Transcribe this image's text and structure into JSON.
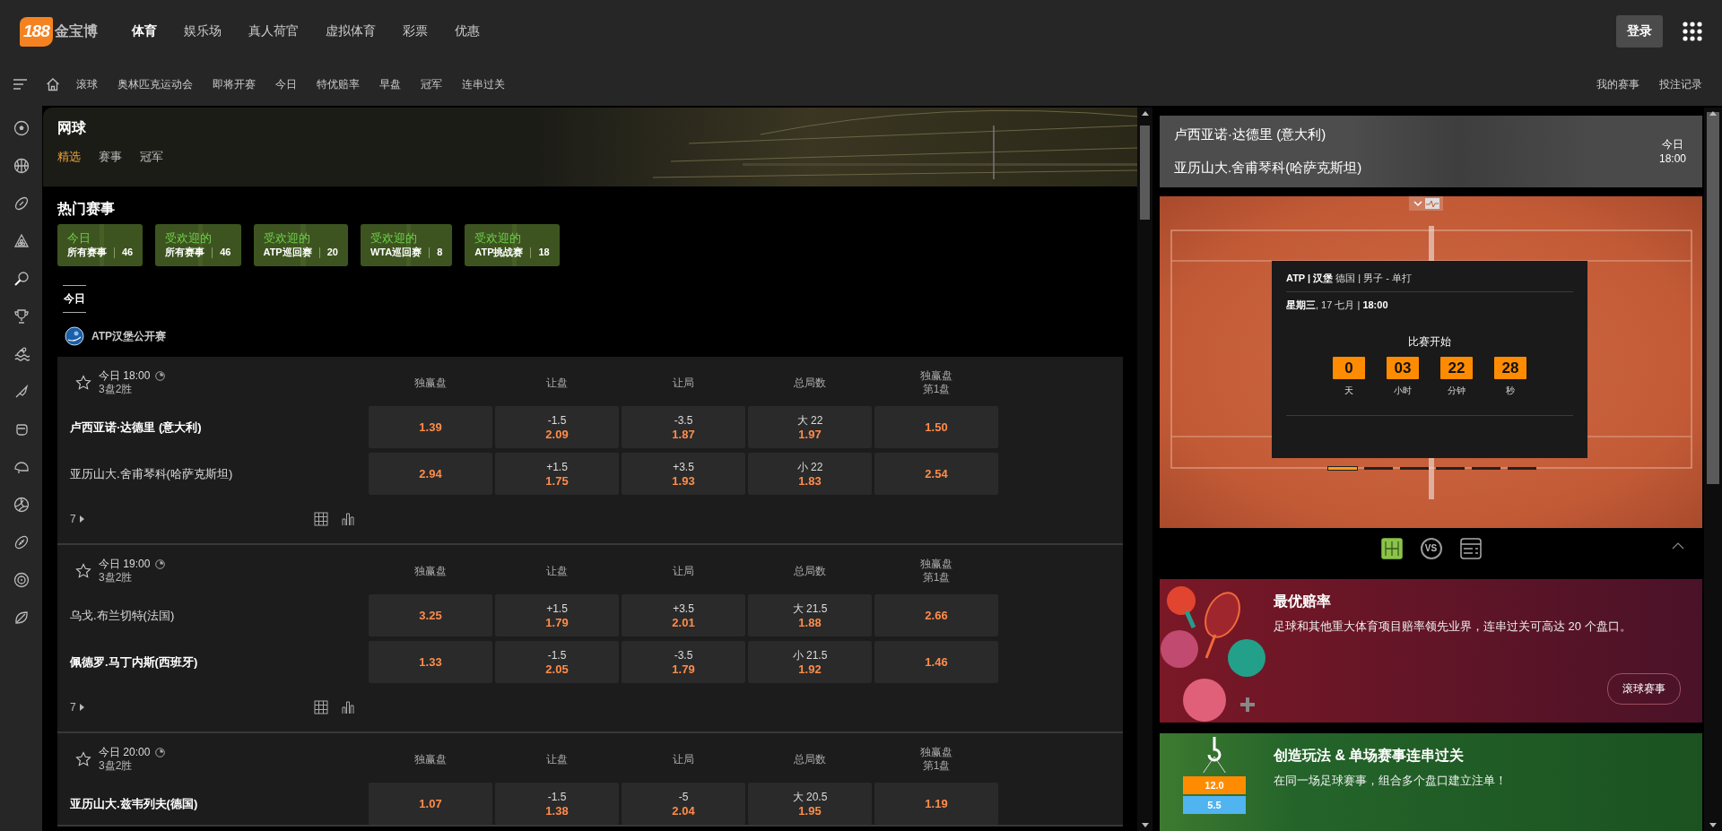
{
  "header": {
    "logo": {
      "badge": "188",
      "text": "金宝博"
    },
    "nav": [
      {
        "label": "体育",
        "selected": true
      },
      {
        "label": "娱乐场",
        "selected": false
      },
      {
        "label": "真人荷官",
        "selected": false
      },
      {
        "label": "虚拟体育",
        "selected": false
      },
      {
        "label": "彩票",
        "selected": false
      },
      {
        "label": "优惠",
        "selected": false
      }
    ],
    "login_button": "登录"
  },
  "subnav": {
    "items": [
      "滚球",
      "奥林匹克运动会",
      "即将开赛",
      "今日",
      "特优赔率",
      "早盘",
      "冠军",
      "连串过关"
    ],
    "links": [
      "我的赛事",
      "投注记录"
    ]
  },
  "sport": {
    "title": "网球",
    "tabs": [
      {
        "label": "精选",
        "selected": true
      },
      {
        "label": "赛事",
        "selected": false
      },
      {
        "label": "冠军",
        "selected": false
      }
    ],
    "hot_title": "热门赛事",
    "hot_events": [
      {
        "top": "今日",
        "label": "所有赛事",
        "count": "46"
      },
      {
        "top": "受欢迎的",
        "label": "所有赛事",
        "count": "46"
      },
      {
        "top": "受欢迎的",
        "label": "ATP巡回赛",
        "count": "20"
      },
      {
        "top": "受欢迎的",
        "label": "WTA巡回赛",
        "count": "8"
      },
      {
        "top": "受欢迎的",
        "label": "ATP挑战赛",
        "count": "18"
      }
    ],
    "date_tabs": [
      {
        "label": "今日",
        "selected": true
      }
    ],
    "league": "ATP汉堡公开赛",
    "matches": [
      {
        "time": "今日 18:00",
        "format": "3盘2胜",
        "columns": [
          {
            "label": "独赢盘"
          },
          {
            "label": "让盘"
          },
          {
            "label": "让局"
          },
          {
            "label": "总局数"
          },
          {
            "label": "独赢盘",
            "sub": "第1盘"
          }
        ],
        "more": "7",
        "teams": [
          {
            "name": "卢西亚诺·达德里 (意大利)",
            "favorite": true,
            "odds": [
              {
                "price": "1.39"
              },
              {
                "line": "-1.5",
                "price": "2.09"
              },
              {
                "line": "-3.5",
                "price": "1.87"
              },
              {
                "line": "大 22",
                "price": "1.97"
              },
              {
                "price": "1.50"
              }
            ]
          },
          {
            "name": "亚历山大.舍甫琴科(哈萨克斯坦)",
            "favorite": false,
            "odds": [
              {
                "price": "2.94"
              },
              {
                "line": "+1.5",
                "price": "1.75"
              },
              {
                "line": "+3.5",
                "price": "1.93"
              },
              {
                "line": "小 22",
                "price": "1.83"
              },
              {
                "price": "2.54"
              }
            ]
          }
        ]
      },
      {
        "time": "今日 19:00",
        "format": "3盘2胜",
        "columns": [
          {
            "label": "独赢盘"
          },
          {
            "label": "让盘"
          },
          {
            "label": "让局"
          },
          {
            "label": "总局数"
          },
          {
            "label": "独赢盘",
            "sub": "第1盘"
          }
        ],
        "more": "7",
        "teams": [
          {
            "name": "乌戈.布兰切特(法国)",
            "favorite": false,
            "odds": [
              {
                "price": "3.25"
              },
              {
                "line": "+1.5",
                "price": "1.79"
              },
              {
                "line": "+3.5",
                "price": "2.01"
              },
              {
                "line": "大 21.5",
                "price": "1.88"
              },
              {
                "price": "2.66"
              }
            ]
          },
          {
            "name": "佩德罗.马丁内斯(西班牙)",
            "favorite": true,
            "odds": [
              {
                "price": "1.33"
              },
              {
                "line": "-1.5",
                "price": "2.05"
              },
              {
                "line": "-3.5",
                "price": "1.79"
              },
              {
                "line": "小 21.5",
                "price": "1.92"
              },
              {
                "price": "1.46"
              }
            ]
          }
        ]
      },
      {
        "time": "今日 20:00",
        "format": "3盘2胜",
        "columns": [
          {
            "label": "独赢盘"
          },
          {
            "label": "让盘"
          },
          {
            "label": "让局"
          },
          {
            "label": "总局数"
          },
          {
            "label": "独赢盘",
            "sub": "第1盘"
          }
        ],
        "teams": [
          {
            "name": "亚历山大.兹韦列夫(德国)",
            "favorite": true,
            "odds": [
              {
                "price": "1.07"
              },
              {
                "line": "-1.5",
                "price": "1.38"
              },
              {
                "line": "-5",
                "price": "2.04"
              },
              {
                "line": "大 20.5",
                "price": "1.95"
              },
              {
                "price": "1.19"
              }
            ]
          }
        ]
      }
    ]
  },
  "tracker": {
    "home": "卢西亚诺·达德里 (意大利)",
    "away": "亚历山大.舍甫琴科(哈萨克斯坦)",
    "day": "今日",
    "time": "18:00",
    "info": "**ATP | 汉堡** 德国 | 男子 - 单打",
    "date": "**星期三**, 17 七月 | **18:00**",
    "countdown_title": "比赛开始",
    "countdown": [
      {
        "value": "0",
        "unit": "天"
      },
      {
        "value": "03",
        "unit": "小时"
      },
      {
        "value": "22",
        "unit": "分钟"
      },
      {
        "value": "28",
        "unit": "秒"
      }
    ],
    "slides": [
      {
        "selected": true
      },
      {
        "selected": false
      },
      {
        "selected": false
      },
      {
        "selected": false
      },
      {
        "selected": false
      },
      {
        "selected": false
      }
    ],
    "views": [
      {
        "kind": "court",
        "selected": true
      },
      {
        "kind": "versus",
        "label": "VS",
        "selected": false
      },
      {
        "kind": "list",
        "selected": false
      }
    ]
  },
  "promos": [
    {
      "kind": "odds",
      "title": "最优赔率",
      "text": "足球和其他重大体育项目赔率领先业界，连串过关可高达 20 个盘口。",
      "button": "滚球赛事"
    },
    {
      "kind": "builder",
      "title": "创造玩法 & 单场赛事连串过关",
      "text": "在同一场足球赛事，组合多个盘口建立注单！",
      "tiles": [
        {
          "value": "12.0",
          "color": "#ff8c00"
        },
        {
          "value": "5.5",
          "color": "#4fb4ef"
        }
      ]
    }
  ]
}
